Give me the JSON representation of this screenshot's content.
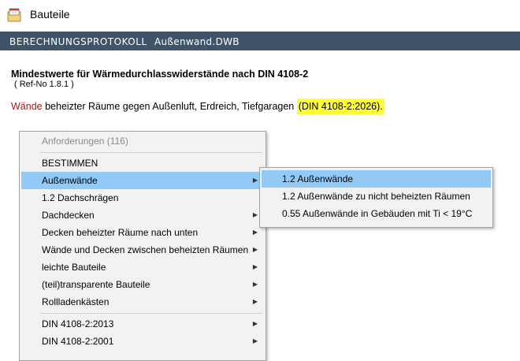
{
  "window": {
    "title": "Bauteile",
    "icon": "folder-calendar-icon"
  },
  "header": {
    "left": "BERECHNUNGSPROTOKOLL",
    "right": "Außenwand.DWB"
  },
  "content": {
    "title": "Mindestwerte für Wärmedurchlasswiderstände nach DIN 4108-2",
    "ref": "( Ref-No 1.8.1 )",
    "line_red": "Wände",
    "line_mid": " beheizter Räume gegen Außenluft, Erdreich, Tiefgaragen ",
    "line_highlight": "(DIN 4108-2:2026)."
  },
  "menu": {
    "items": [
      {
        "label": "Anforderungen (116)"
      },
      {
        "label": "BESTIMMEN"
      },
      {
        "label": "Außenwände"
      },
      {
        "label": "1.2 Dachschrägen"
      },
      {
        "label": "Dachdecken"
      },
      {
        "label": "Decken beheizter Räume nach unten"
      },
      {
        "label": "Wände und Decken zwischen beheizten Räumen"
      },
      {
        "label": "leichte Bauteile"
      },
      {
        "label": "(teil)transparente Bauteile"
      },
      {
        "label": "Rollladenkästen"
      },
      {
        "label": "DIN 4108-2:2013"
      },
      {
        "label": "DIN 4108-2:2001"
      }
    ],
    "arrow_glyph": "▶"
  },
  "submenu": {
    "items": [
      {
        "label": "1.2 Außenwände"
      },
      {
        "label": "1.2 Außenwände zu nicht beheizten Räumen"
      },
      {
        "label": "0.55 Außenwände in Gebäuden mit Ti < 19°C"
      }
    ]
  },
  "colors": {
    "header_bg": "#3f5469",
    "selection": "#91c9f7",
    "highlight": "#ffff33",
    "accent_red": "#a61b1b"
  }
}
